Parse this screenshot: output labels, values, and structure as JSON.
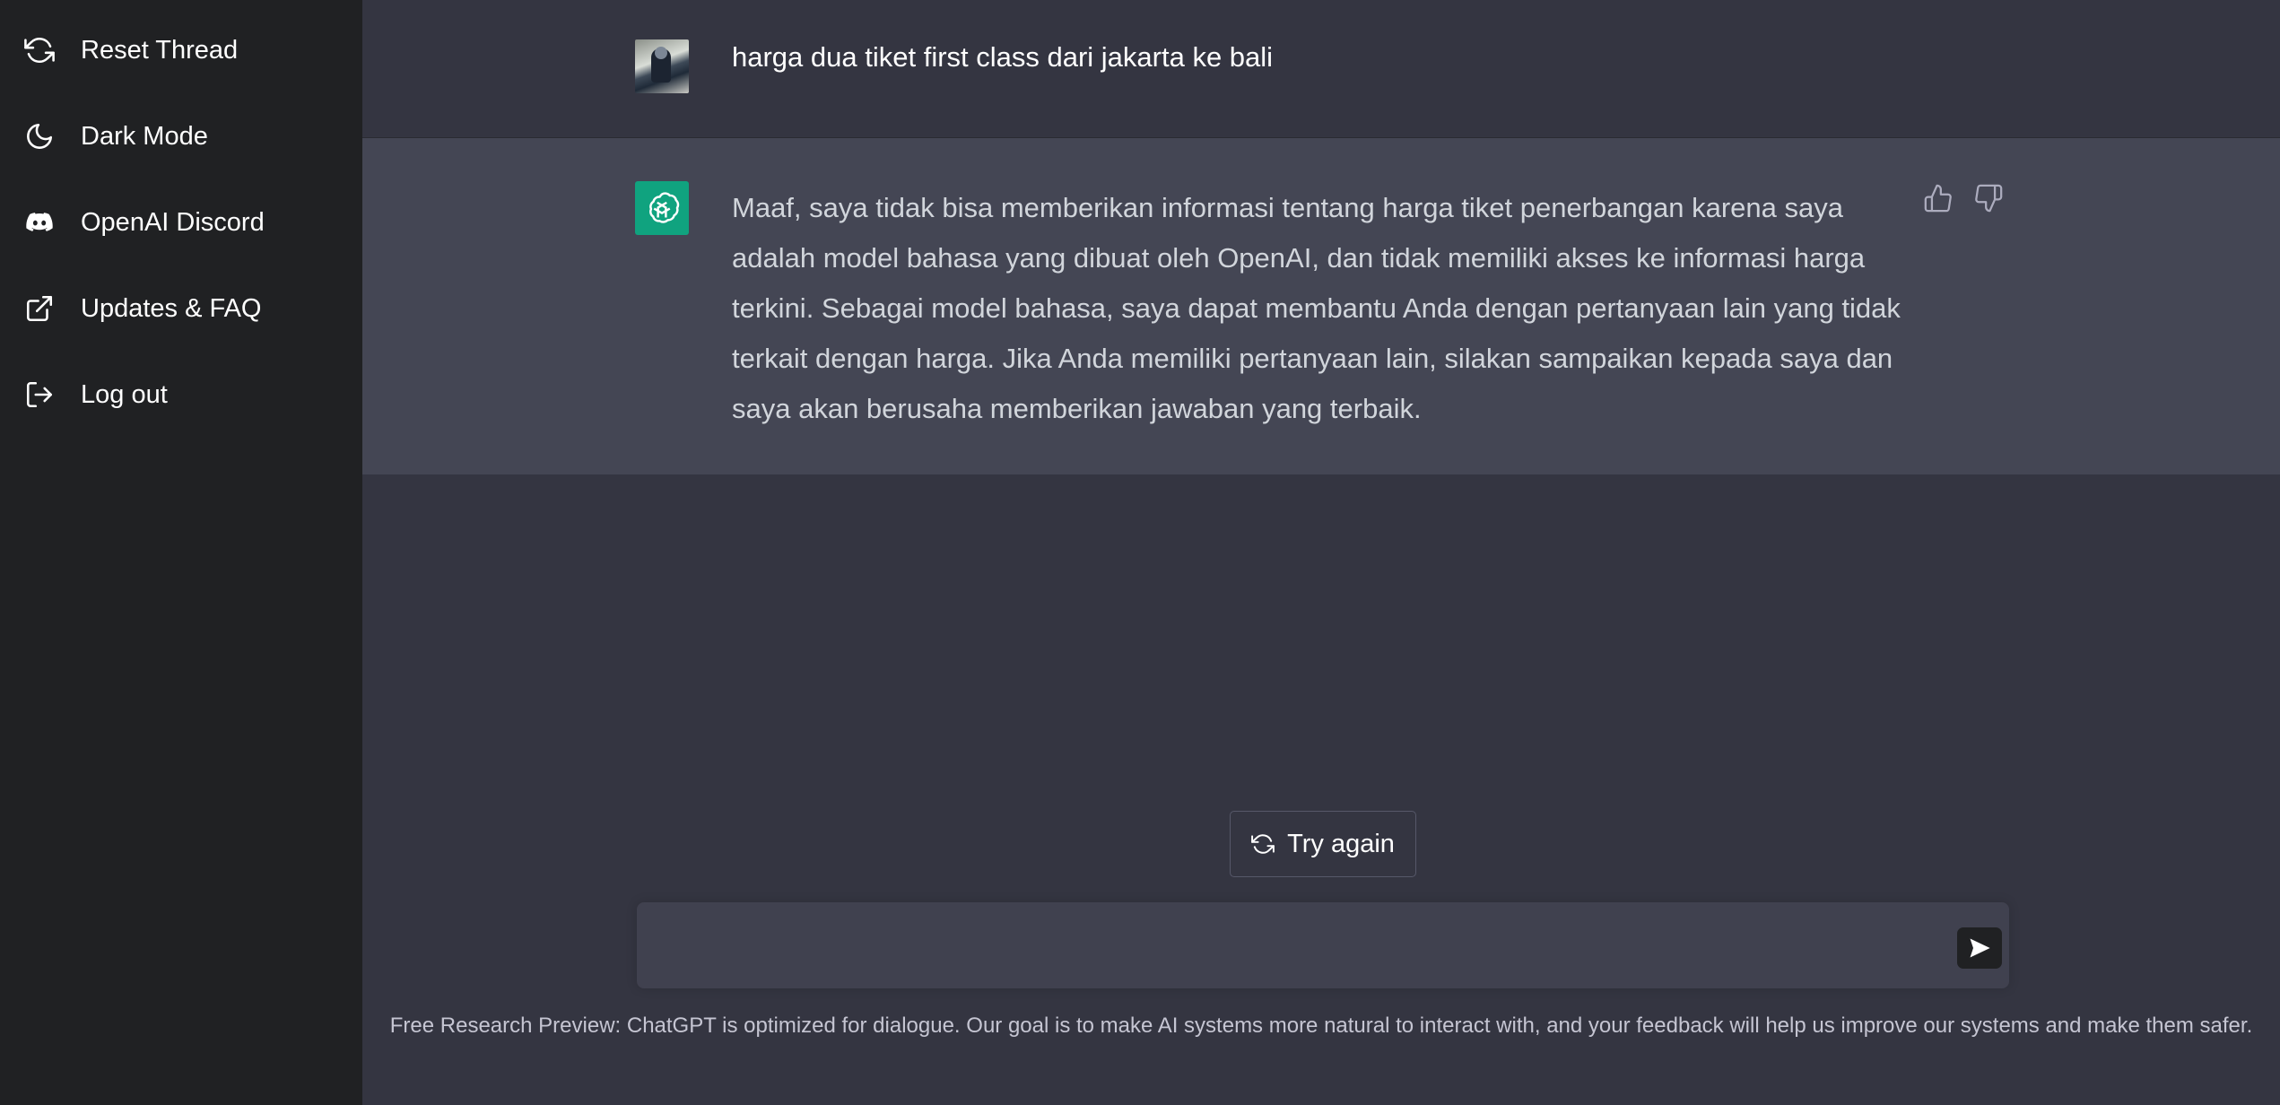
{
  "sidebar": {
    "items": [
      {
        "label": "Reset Thread",
        "icon": "refresh-icon"
      },
      {
        "label": "Dark Mode",
        "icon": "moon-icon"
      },
      {
        "label": "OpenAI Discord",
        "icon": "discord-icon"
      },
      {
        "label": "Updates & FAQ",
        "icon": "external-link-icon"
      },
      {
        "label": "Log out",
        "icon": "logout-icon"
      }
    ]
  },
  "conversation": {
    "user_message": "harga dua tiket first class dari jakarta ke bali",
    "assistant_message": "Maaf, saya tidak bisa memberikan informasi tentang harga tiket penerbangan karena saya adalah model bahasa yang dibuat oleh OpenAI, dan tidak memiliki akses ke informasi harga terkini. Sebagai model bahasa, saya dapat membantu Anda dengan pertanyaan lain yang tidak terkait dengan harga. Jika Anda memiliki pertanyaan lain, silakan sampaikan kepada saya dan saya akan berusaha memberikan jawaban yang terbaik."
  },
  "actions": {
    "try_again_label": "Try again"
  },
  "composer": {
    "value": "",
    "placeholder": ""
  },
  "footer": {
    "note": "Free Research Preview: ChatGPT is optimized for dialogue. Our goal is to make AI systems more natural to interact with, and your feedback will help us improve our systems and make them safer."
  },
  "colors": {
    "sidebar_bg": "#202123",
    "main_bg": "#343541",
    "assistant_row_bg": "#444654",
    "brand_green": "#10a37f"
  }
}
